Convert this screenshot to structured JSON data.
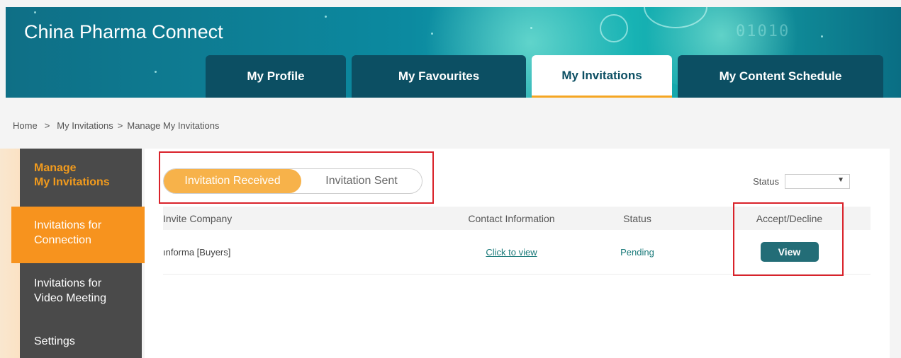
{
  "header": {
    "site_title": "China Pharma Connect",
    "tabs": [
      {
        "label": "My Profile",
        "active": false
      },
      {
        "label": "My Favourites",
        "active": false
      },
      {
        "label": "My Invitations",
        "active": true
      },
      {
        "label": "My Content Schedule",
        "active": false
      }
    ]
  },
  "breadcrumb": {
    "items": [
      "Home",
      ">",
      "My Invitations",
      ">",
      "Manage My Invitations"
    ]
  },
  "sidebar": {
    "heading_line1": "Manage",
    "heading_line2": "My Invitations",
    "items": [
      {
        "line1": "Invitations for",
        "line2": "Connection",
        "active": true
      },
      {
        "line1": "Invitations for",
        "line2": "Video Meeting",
        "active": false
      },
      {
        "line1": "Settings",
        "line2": "",
        "active": false
      }
    ]
  },
  "toggle": {
    "received_label": "Invitation Received",
    "sent_label": "Invitation Sent",
    "selected": "received"
  },
  "status_filter": {
    "label": "Status",
    "value": ""
  },
  "table": {
    "columns": [
      "Invite Company",
      "Contact Information",
      "Status",
      "Accept/Decline"
    ],
    "rows": [
      {
        "company": "ınforma [Buyers]",
        "contact_link": "Click to view",
        "status": "Pending",
        "action_label": "View"
      }
    ]
  },
  "colors": {
    "header_teal": "#0c8aa0",
    "tab_dark": "#0c4f63",
    "accent_orange": "#f7931e",
    "sidebar_bg": "#4a4a4a",
    "view_button": "#236d77",
    "highlight_red": "#d9222a"
  },
  "icons": [
    "chevron-down-icon"
  ]
}
